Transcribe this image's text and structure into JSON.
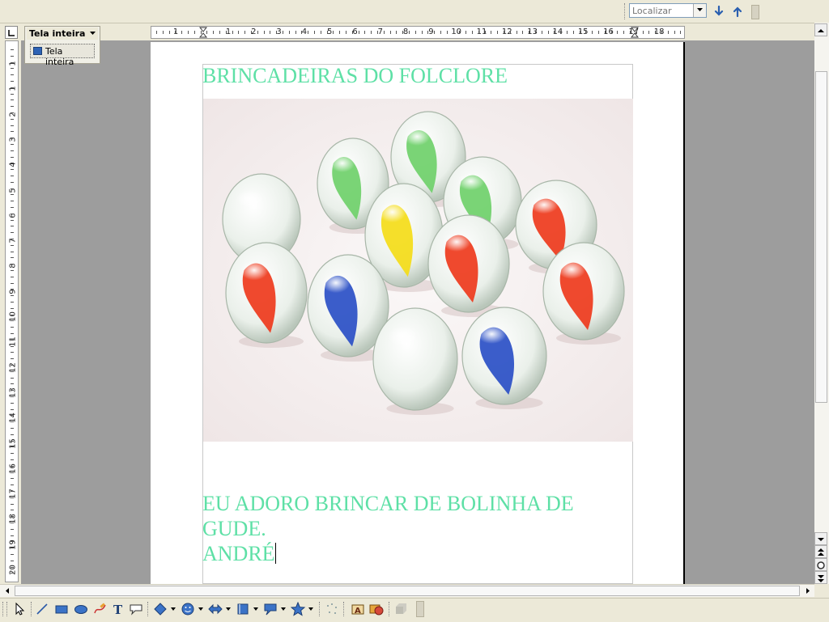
{
  "findbar": {
    "placeholder": "Localizar",
    "next_icon": "arrow-down-icon",
    "prev_icon": "arrow-up-icon"
  },
  "fullscreen_toolbar": {
    "title": "Tela inteira",
    "button_label": "Tela inteira"
  },
  "ruler": {
    "horizontal_numbers": [
      "1",
      "1",
      "2",
      "3",
      "4",
      "5",
      "6",
      "7",
      "8",
      "9",
      "10",
      "11",
      "12",
      "13",
      "14",
      "15",
      "16",
      "17",
      "18"
    ],
    "vertical_numbers": [
      "1",
      "1",
      "2",
      "3",
      "4",
      "5",
      "6",
      "7",
      "8",
      "9",
      "10",
      "11",
      "12",
      "13",
      "14",
      "15",
      "16",
      "17",
      "18",
      "19",
      "20"
    ]
  },
  "document": {
    "title": "BRINCADEIRAS DO FOLCLORE",
    "body_line1": "EU ADORO BRINCAR DE BOLINHA DE",
    "body_line2": "GUDE.",
    "body_line3": "ANDRÉ",
    "text_color": "#5ee0a6",
    "picture": {
      "subject": "glass marbles",
      "marbles": [
        {
          "color": "clear"
        },
        {
          "color": "green"
        },
        {
          "color": "green"
        },
        {
          "color": "green"
        },
        {
          "color": "red"
        },
        {
          "color": "yellow"
        },
        {
          "color": "red"
        },
        {
          "color": "red"
        },
        {
          "color": "red"
        },
        {
          "color": "blue"
        },
        {
          "color": "clear"
        },
        {
          "color": "blue"
        }
      ]
    }
  },
  "drawing_toolbar": {
    "tools": [
      "select-icon",
      "line-icon",
      "rectangle-icon",
      "ellipse-icon",
      "freeform-icon",
      "text-icon",
      "callout-icon",
      "basic-shapes-icon",
      "symbol-shapes-icon",
      "block-arrows-icon",
      "flowchart-icon",
      "callouts-icon",
      "stars-icon",
      "points-icon",
      "fontwork-icon",
      "from-file-icon",
      "extrusion-icon"
    ]
  }
}
